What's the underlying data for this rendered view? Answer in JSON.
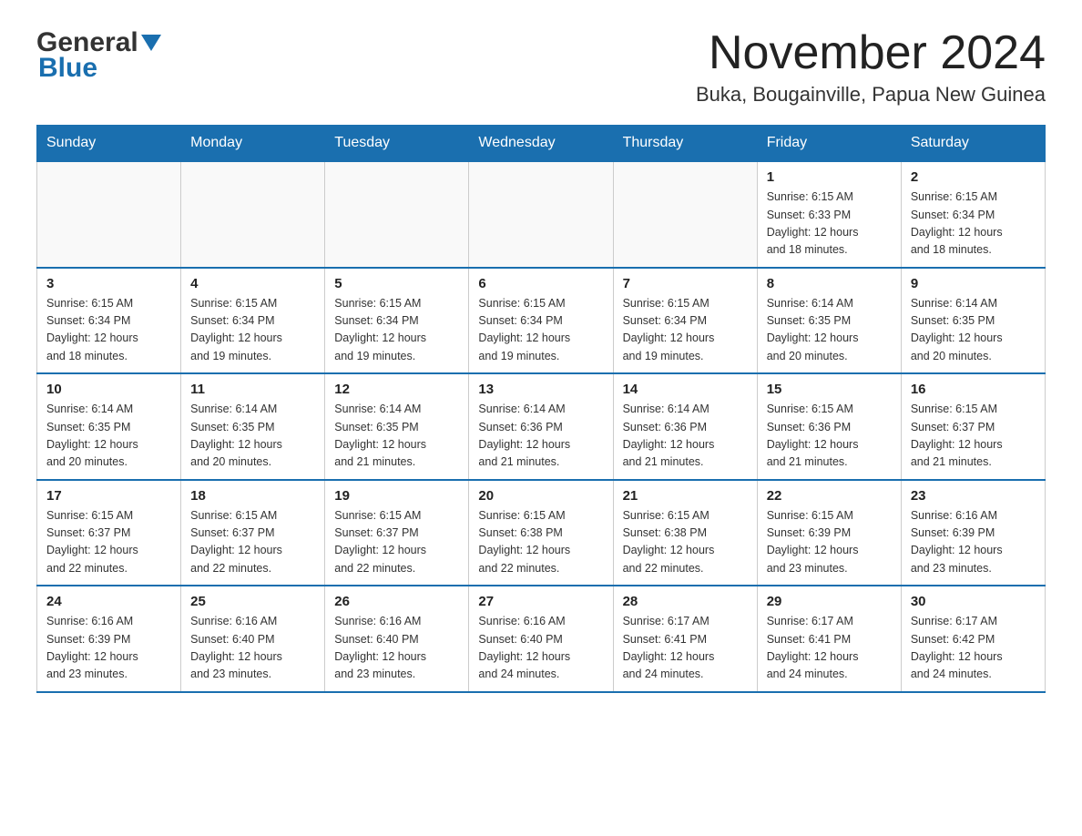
{
  "header": {
    "logo_general": "General",
    "logo_blue": "Blue",
    "month_title": "November 2024",
    "location": "Buka, Bougainville, Papua New Guinea"
  },
  "weekdays": [
    "Sunday",
    "Monday",
    "Tuesday",
    "Wednesday",
    "Thursday",
    "Friday",
    "Saturday"
  ],
  "weeks": [
    [
      {
        "day": "",
        "info": ""
      },
      {
        "day": "",
        "info": ""
      },
      {
        "day": "",
        "info": ""
      },
      {
        "day": "",
        "info": ""
      },
      {
        "day": "",
        "info": ""
      },
      {
        "day": "1",
        "info": "Sunrise: 6:15 AM\nSunset: 6:33 PM\nDaylight: 12 hours\nand 18 minutes."
      },
      {
        "day": "2",
        "info": "Sunrise: 6:15 AM\nSunset: 6:34 PM\nDaylight: 12 hours\nand 18 minutes."
      }
    ],
    [
      {
        "day": "3",
        "info": "Sunrise: 6:15 AM\nSunset: 6:34 PM\nDaylight: 12 hours\nand 18 minutes."
      },
      {
        "day": "4",
        "info": "Sunrise: 6:15 AM\nSunset: 6:34 PM\nDaylight: 12 hours\nand 19 minutes."
      },
      {
        "day": "5",
        "info": "Sunrise: 6:15 AM\nSunset: 6:34 PM\nDaylight: 12 hours\nand 19 minutes."
      },
      {
        "day": "6",
        "info": "Sunrise: 6:15 AM\nSunset: 6:34 PM\nDaylight: 12 hours\nand 19 minutes."
      },
      {
        "day": "7",
        "info": "Sunrise: 6:15 AM\nSunset: 6:34 PM\nDaylight: 12 hours\nand 19 minutes."
      },
      {
        "day": "8",
        "info": "Sunrise: 6:14 AM\nSunset: 6:35 PM\nDaylight: 12 hours\nand 20 minutes."
      },
      {
        "day": "9",
        "info": "Sunrise: 6:14 AM\nSunset: 6:35 PM\nDaylight: 12 hours\nand 20 minutes."
      }
    ],
    [
      {
        "day": "10",
        "info": "Sunrise: 6:14 AM\nSunset: 6:35 PM\nDaylight: 12 hours\nand 20 minutes."
      },
      {
        "day": "11",
        "info": "Sunrise: 6:14 AM\nSunset: 6:35 PM\nDaylight: 12 hours\nand 20 minutes."
      },
      {
        "day": "12",
        "info": "Sunrise: 6:14 AM\nSunset: 6:35 PM\nDaylight: 12 hours\nand 21 minutes."
      },
      {
        "day": "13",
        "info": "Sunrise: 6:14 AM\nSunset: 6:36 PM\nDaylight: 12 hours\nand 21 minutes."
      },
      {
        "day": "14",
        "info": "Sunrise: 6:14 AM\nSunset: 6:36 PM\nDaylight: 12 hours\nand 21 minutes."
      },
      {
        "day": "15",
        "info": "Sunrise: 6:15 AM\nSunset: 6:36 PM\nDaylight: 12 hours\nand 21 minutes."
      },
      {
        "day": "16",
        "info": "Sunrise: 6:15 AM\nSunset: 6:37 PM\nDaylight: 12 hours\nand 21 minutes."
      }
    ],
    [
      {
        "day": "17",
        "info": "Sunrise: 6:15 AM\nSunset: 6:37 PM\nDaylight: 12 hours\nand 22 minutes."
      },
      {
        "day": "18",
        "info": "Sunrise: 6:15 AM\nSunset: 6:37 PM\nDaylight: 12 hours\nand 22 minutes."
      },
      {
        "day": "19",
        "info": "Sunrise: 6:15 AM\nSunset: 6:37 PM\nDaylight: 12 hours\nand 22 minutes."
      },
      {
        "day": "20",
        "info": "Sunrise: 6:15 AM\nSunset: 6:38 PM\nDaylight: 12 hours\nand 22 minutes."
      },
      {
        "day": "21",
        "info": "Sunrise: 6:15 AM\nSunset: 6:38 PM\nDaylight: 12 hours\nand 22 minutes."
      },
      {
        "day": "22",
        "info": "Sunrise: 6:15 AM\nSunset: 6:39 PM\nDaylight: 12 hours\nand 23 minutes."
      },
      {
        "day": "23",
        "info": "Sunrise: 6:16 AM\nSunset: 6:39 PM\nDaylight: 12 hours\nand 23 minutes."
      }
    ],
    [
      {
        "day": "24",
        "info": "Sunrise: 6:16 AM\nSunset: 6:39 PM\nDaylight: 12 hours\nand 23 minutes."
      },
      {
        "day": "25",
        "info": "Sunrise: 6:16 AM\nSunset: 6:40 PM\nDaylight: 12 hours\nand 23 minutes."
      },
      {
        "day": "26",
        "info": "Sunrise: 6:16 AM\nSunset: 6:40 PM\nDaylight: 12 hours\nand 23 minutes."
      },
      {
        "day": "27",
        "info": "Sunrise: 6:16 AM\nSunset: 6:40 PM\nDaylight: 12 hours\nand 24 minutes."
      },
      {
        "day": "28",
        "info": "Sunrise: 6:17 AM\nSunset: 6:41 PM\nDaylight: 12 hours\nand 24 minutes."
      },
      {
        "day": "29",
        "info": "Sunrise: 6:17 AM\nSunset: 6:41 PM\nDaylight: 12 hours\nand 24 minutes."
      },
      {
        "day": "30",
        "info": "Sunrise: 6:17 AM\nSunset: 6:42 PM\nDaylight: 12 hours\nand 24 minutes."
      }
    ]
  ]
}
